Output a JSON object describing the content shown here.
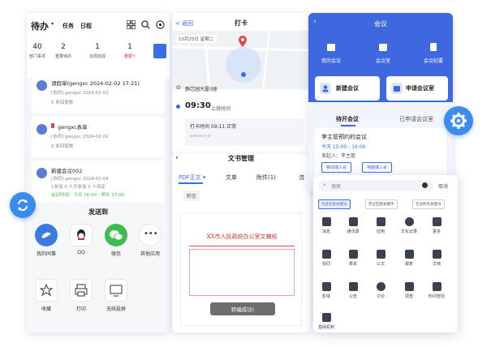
{
  "todo": {
    "title": "待办",
    "tabs": [
      "任务",
      "日程"
    ],
    "stats": [
      {
        "value": "40",
        "label": "部门事项"
      },
      {
        "value": "2",
        "label": "重要待办"
      },
      {
        "value": "1",
        "label": "本周完成"
      },
      {
        "value": "1",
        "label": "重要!!"
      }
    ],
    "cards": [
      {
        "title": "请假单(gengxc 2024-02-02 17:21)",
        "meta": "[协同]  gengxc    2024-02-02",
        "sub": "0 条回复数"
      },
      {
        "title": "gengxc表单",
        "meta": "[协同]  gengxc    2024-02-02",
        "sub": "0 条回复数"
      },
      {
        "title": "新建会议002",
        "meta": "[协同]  gengxc    2024-02-04",
        "sub": "1参加   0 人不参加   0 人待定",
        "time": "会议时间：今天 16:00 - 明天 17:00"
      }
    ]
  },
  "share": {
    "title": "发送到",
    "row1": [
      {
        "label": "我的同事",
        "color": "#3a7be0"
      },
      {
        "label": "QQ",
        "color": "#ffffff"
      },
      {
        "label": "微信",
        "color": "#3cbd4f"
      },
      {
        "label": "其他应用",
        "color": "#ffffff"
      }
    ],
    "row2": [
      {
        "label": "收藏"
      },
      {
        "label": "打印"
      },
      {
        "label": "无线投屏"
      }
    ]
  },
  "checkin": {
    "back": "返回",
    "title": "打卡",
    "date": "10月25日 星期二",
    "location": "静芯园大厦0座",
    "time": "09:30",
    "time_label": "上班时间",
    "record": "打卡时间 09:11    正常",
    "record_sub": "wanyun-yl"
  },
  "doc": {
    "title": "文书管理",
    "tabs": [
      "PDF正文",
      "文单",
      "附件(1)",
      "流"
    ],
    "sub_tab": "附言",
    "doc_title": "XX市人民政府办公室文稿纸",
    "toast": "转编成功!"
  },
  "meeting": {
    "title": "会议",
    "top_items": [
      "我的会议",
      "会议室",
      "会议纪要"
    ],
    "actions": [
      "新建会议",
      "申请会议室"
    ],
    "tabs": [
      "待开会议",
      "已申请会议室"
    ],
    "item_title": "李主管预约的会议",
    "item_time": "今天 15:00 - 16:00",
    "item_host": "发起人：李主管",
    "item_buttons": [
      "移动端入会",
      "电脑端入会"
    ]
  },
  "apps": {
    "search_placeholder": "搜索",
    "cancel": "取消",
    "filters": [
      "包含任意关键词",
      "完全匹配关键字",
      "包含所有关键词"
    ],
    "grid": [
      "消息",
      "通讯录",
      "应用",
      "文化记录",
      "更多",
      "协同",
      "表单",
      "公文",
      "报表",
      "文档",
      "影响",
      "公告",
      "讨论",
      "调查",
      "时间管控"
    ],
    "last": "基础机制"
  },
  "colors": {
    "accent": "#3a6ee8",
    "blue_header": "#3f67e0",
    "green": "#3cbd4f"
  }
}
